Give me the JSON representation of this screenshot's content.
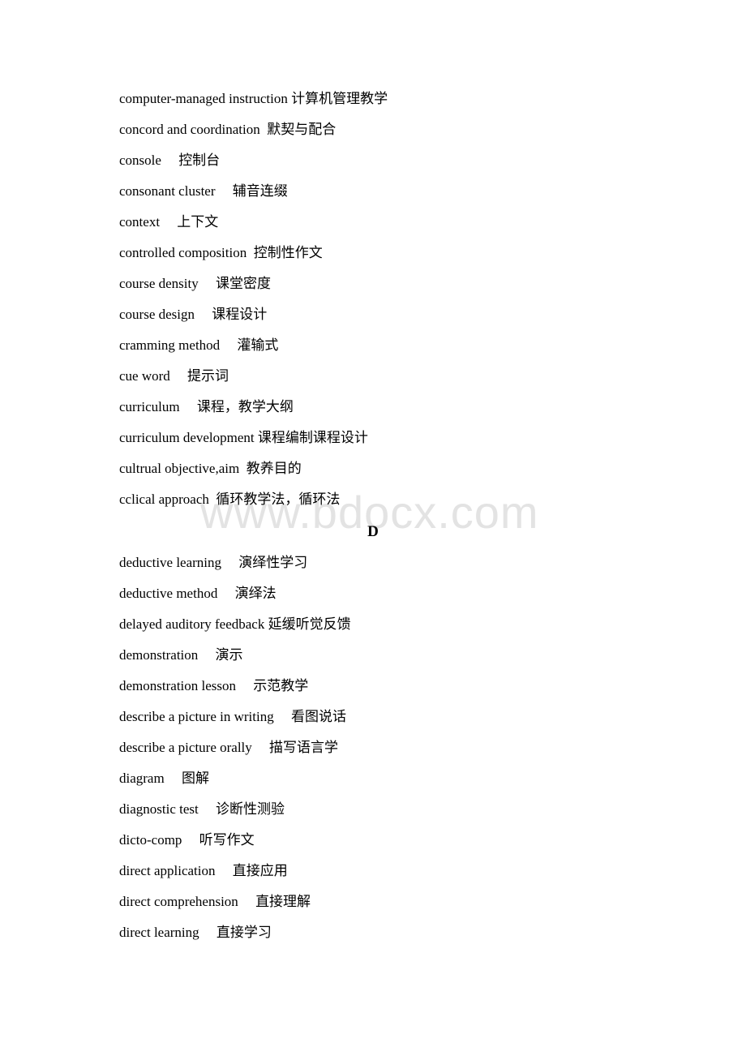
{
  "watermark": "www.bdocx.com",
  "section_c_entries": [
    {
      "term": "computer-managed instruction",
      "sep": " ",
      "cn": "计算机管理教学"
    },
    {
      "term": "concord and coordination",
      "sep": "  ",
      "cn": "默契与配合"
    },
    {
      "term": "console",
      "sep": "     ",
      "cn": "控制台"
    },
    {
      "term": "consonant cluster",
      "sep": "     ",
      "cn": "辅音连缀"
    },
    {
      "term": "context",
      "sep": "     ",
      "cn": "上下文"
    },
    {
      "term": "controlled composition",
      "sep": "  ",
      "cn": "控制性作文"
    },
    {
      "term": "course density",
      "sep": "     ",
      "cn": "课堂密度"
    },
    {
      "term": "course design",
      "sep": "     ",
      "cn": "课程设计"
    },
    {
      "term": "cramming method",
      "sep": "     ",
      "cn": "灌输式"
    },
    {
      "term": "cue word",
      "sep": "     ",
      "cn": "提示词"
    },
    {
      "term": "curriculum",
      "sep": "     ",
      "cn": "课程，教学大纲"
    },
    {
      "term": "curriculum development",
      "sep": " ",
      "cn": "课程编制课程设计"
    },
    {
      "term": "cultrual objective,aim",
      "sep": "  ",
      "cn": "教养目的"
    },
    {
      "term": "cclical approach",
      "sep": "  ",
      "cn": "循环教学法，循环法"
    }
  ],
  "section_d_heading": "D",
  "section_d_entries": [
    {
      "term": "deductive learning",
      "sep": "     ",
      "cn": "演绎性学习"
    },
    {
      "term": "deductive method",
      "sep": "     ",
      "cn": "演绎法"
    },
    {
      "term": "delayed auditory feedback",
      "sep": " ",
      "cn": "延缓听觉反馈"
    },
    {
      "term": "demonstration",
      "sep": "     ",
      "cn": "演示"
    },
    {
      "term": "demonstration lesson",
      "sep": "     ",
      "cn": "示范教学"
    },
    {
      "term": "describe a picture in writing",
      "sep": "     ",
      "cn": "看图说话"
    },
    {
      "term": "describe a picture orally",
      "sep": "     ",
      "cn": "描写语言学"
    },
    {
      "term": "diagram",
      "sep": "     ",
      "cn": "图解"
    },
    {
      "term": "diagnostic test",
      "sep": "     ",
      "cn": "诊断性测验"
    },
    {
      "term": "dicto-comp",
      "sep": "     ",
      "cn": "听写作文"
    },
    {
      "term": "direct application",
      "sep": "     ",
      "cn": "直接应用"
    },
    {
      "term": "direct comprehension",
      "sep": "     ",
      "cn": "直接理解"
    },
    {
      "term": "direct learning",
      "sep": "     ",
      "cn": "直接学习"
    }
  ]
}
